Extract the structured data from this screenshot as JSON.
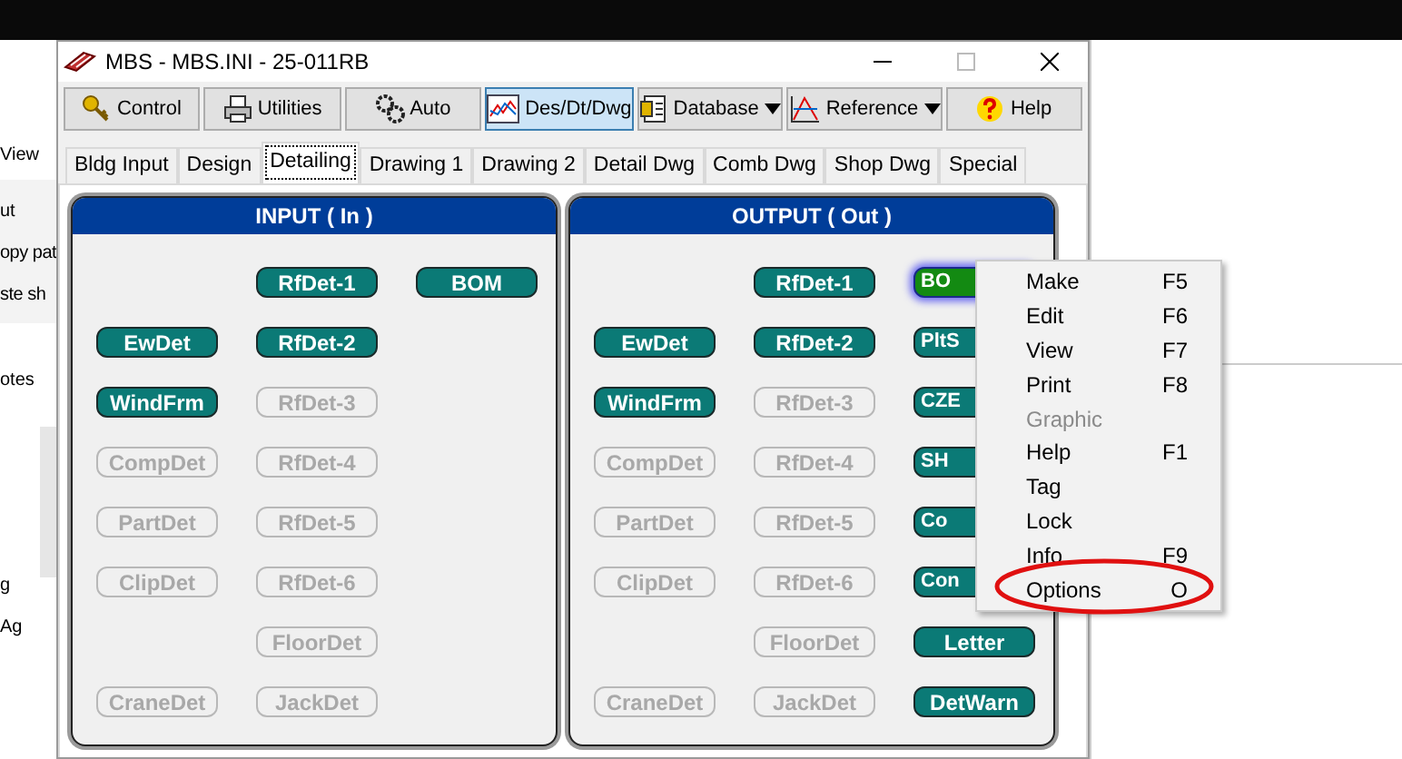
{
  "background_window": {
    "texts": [
      "View",
      "ut",
      "opy pat",
      "ste sh",
      "otes",
      "g",
      "Ag"
    ]
  },
  "window": {
    "title": "MBS - MBS.INI - 25-011RB"
  },
  "toolbar": [
    {
      "label": "Control",
      "selected": false,
      "dropdown": false
    },
    {
      "label": "Utilities",
      "selected": false,
      "dropdown": false
    },
    {
      "label": "Auto",
      "selected": false,
      "dropdown": false
    },
    {
      "label": "Des/Dt/Dwg",
      "selected": true,
      "dropdown": false
    },
    {
      "label": "Database",
      "selected": false,
      "dropdown": true
    },
    {
      "label": "Reference",
      "selected": false,
      "dropdown": true
    },
    {
      "label": "Help",
      "selected": false,
      "dropdown": false
    }
  ],
  "tabs": [
    {
      "label": "Bldg Input",
      "selected": false
    },
    {
      "label": "Design",
      "selected": false
    },
    {
      "label": "Detailing",
      "selected": true
    },
    {
      "label": "Drawing 1",
      "selected": false
    },
    {
      "label": "Drawing 2",
      "selected": false
    },
    {
      "label": "Detail Dwg",
      "selected": false
    },
    {
      "label": "Comb Dwg",
      "selected": false
    },
    {
      "label": "Shop Dwg",
      "selected": false
    },
    {
      "label": "Special",
      "selected": false
    }
  ],
  "panels": [
    {
      "title": "INPUT ( In )",
      "rows": [
        [
          {
            "kind": "empty"
          },
          {
            "kind": "button",
            "label": "RfDet-1",
            "enabled": true,
            "selected": false
          },
          {
            "kind": "button",
            "label": "BOM",
            "enabled": true,
            "selected": false
          }
        ],
        [
          {
            "kind": "button",
            "label": "EwDet",
            "enabled": true,
            "selected": false
          },
          {
            "kind": "button",
            "label": "RfDet-2",
            "enabled": true,
            "selected": false
          },
          {
            "kind": "empty"
          }
        ],
        [
          {
            "kind": "button",
            "label": "WindFrm",
            "enabled": true,
            "selected": false
          },
          {
            "kind": "button",
            "label": "RfDet-3",
            "enabled": false,
            "selected": false
          },
          {
            "kind": "empty"
          }
        ],
        [
          {
            "kind": "button",
            "label": "CompDet",
            "enabled": false,
            "selected": false
          },
          {
            "kind": "button",
            "label": "RfDet-4",
            "enabled": false,
            "selected": false
          },
          {
            "kind": "empty"
          }
        ],
        [
          {
            "kind": "button",
            "label": "PartDet",
            "enabled": false,
            "selected": false
          },
          {
            "kind": "button",
            "label": "RfDet-5",
            "enabled": false,
            "selected": false
          },
          {
            "kind": "empty"
          }
        ],
        [
          {
            "kind": "button",
            "label": "ClipDet",
            "enabled": false,
            "selected": false
          },
          {
            "kind": "button",
            "label": "RfDet-6",
            "enabled": false,
            "selected": false
          },
          {
            "kind": "empty"
          }
        ],
        [
          {
            "kind": "empty"
          },
          {
            "kind": "button",
            "label": "FloorDet",
            "enabled": false,
            "selected": false
          },
          {
            "kind": "empty"
          }
        ],
        [
          {
            "kind": "button",
            "label": "CraneDet",
            "enabled": false,
            "selected": false
          },
          {
            "kind": "button",
            "label": "JackDet",
            "enabled": false,
            "selected": false
          },
          {
            "kind": "empty"
          }
        ]
      ]
    },
    {
      "title": "OUTPUT ( Out )",
      "rows": [
        [
          {
            "kind": "empty"
          },
          {
            "kind": "button",
            "label": "RfDet-1",
            "enabled": true,
            "selected": false
          },
          {
            "kind": "button",
            "label": "BO",
            "enabled": true,
            "selected": true,
            "partly_hidden": true
          }
        ],
        [
          {
            "kind": "button",
            "label": "EwDet",
            "enabled": true,
            "selected": false
          },
          {
            "kind": "button",
            "label": "RfDet-2",
            "enabled": true,
            "selected": false
          },
          {
            "kind": "button",
            "label": "PltS",
            "enabled": true,
            "selected": false,
            "partly_hidden": true
          }
        ],
        [
          {
            "kind": "button",
            "label": "WindFrm",
            "enabled": true,
            "selected": false
          },
          {
            "kind": "button",
            "label": "RfDet-3",
            "enabled": false,
            "selected": false
          },
          {
            "kind": "button",
            "label": "CZE",
            "enabled": true,
            "selected": false,
            "partly_hidden": true
          }
        ],
        [
          {
            "kind": "button",
            "label": "CompDet",
            "enabled": false,
            "selected": false
          },
          {
            "kind": "button",
            "label": "RfDet-4",
            "enabled": false,
            "selected": false
          },
          {
            "kind": "button",
            "label": "SH",
            "enabled": true,
            "selected": false,
            "partly_hidden": true
          }
        ],
        [
          {
            "kind": "button",
            "label": "PartDet",
            "enabled": false,
            "selected": false
          },
          {
            "kind": "button",
            "label": "RfDet-5",
            "enabled": false,
            "selected": false
          },
          {
            "kind": "button",
            "label": "Co",
            "enabled": true,
            "selected": false,
            "partly_hidden": true
          }
        ],
        [
          {
            "kind": "button",
            "label": "ClipDet",
            "enabled": false,
            "selected": false
          },
          {
            "kind": "button",
            "label": "RfDet-6",
            "enabled": false,
            "selected": false
          },
          {
            "kind": "button",
            "label": "Con",
            "enabled": true,
            "selected": false,
            "partly_hidden": true
          }
        ],
        [
          {
            "kind": "empty"
          },
          {
            "kind": "button",
            "label": "FloorDet",
            "enabled": false,
            "selected": false
          },
          {
            "kind": "button",
            "label": "Letter",
            "enabled": true,
            "selected": false
          }
        ],
        [
          {
            "kind": "button",
            "label": "CraneDet",
            "enabled": false,
            "selected": false
          },
          {
            "kind": "button",
            "label": "JackDet",
            "enabled": false,
            "selected": false
          },
          {
            "kind": "button",
            "label": "DetWarn",
            "enabled": true,
            "selected": false
          }
        ]
      ]
    }
  ],
  "context_menu": [
    {
      "label": "Make",
      "shortcut": "F5",
      "disabled": false,
      "circled": false
    },
    {
      "label": "Edit",
      "shortcut": "F6",
      "disabled": false,
      "circled": false
    },
    {
      "label": "View",
      "shortcut": "F7",
      "disabled": false,
      "circled": false
    },
    {
      "label": "Print",
      "shortcut": "F8",
      "disabled": false,
      "circled": false
    },
    {
      "label": "Graphic",
      "disabled": true,
      "circled": false
    },
    {
      "label": "Help",
      "shortcut": "F1",
      "disabled": false,
      "circled": false
    },
    {
      "label": "Tag",
      "disabled": false,
      "circled": false
    },
    {
      "label": "Lock",
      "disabled": false,
      "circled": false
    },
    {
      "label": "Info",
      "shortcut": "F9",
      "disabled": false,
      "circled": false
    },
    {
      "label": "Options",
      "shortcut": "O",
      "disabled": false,
      "circled": true
    }
  ]
}
